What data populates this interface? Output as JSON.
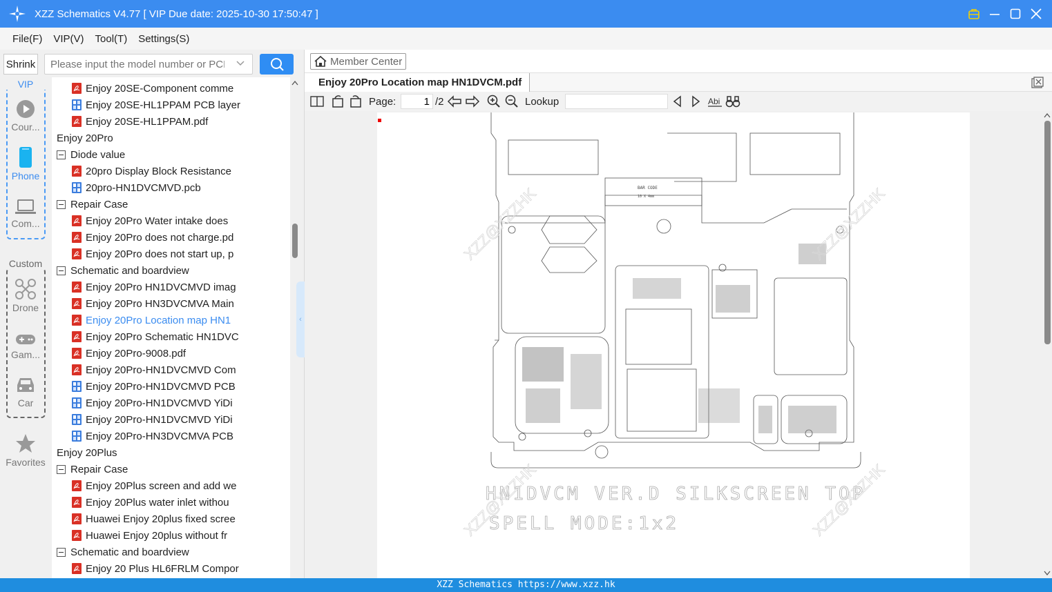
{
  "window": {
    "title": "XZZ Schematics V4.77 [ VIP Due date: 2025-10-30 17:50:47 ]"
  },
  "menu": [
    "File(F)",
    "VIP(V)",
    "Tool(T)",
    "Settings(S)"
  ],
  "sidebar": {
    "shrink_label": "Shrink",
    "search_placeholder": "Please input the model number or PCB",
    "vip_label": "VIP",
    "custom_label": "Custom",
    "categories": {
      "course": "Cour...",
      "phone": "Phone",
      "computer": "Com...",
      "drone": "Drone",
      "game": "Gam...",
      "car": "Car",
      "favorites": "Favorites"
    }
  },
  "tree": [
    {
      "level": 2,
      "kind": "pdf",
      "label": "Enjoy 20SE-Component comme"
    },
    {
      "level": 2,
      "kind": "pcb",
      "label": "Enjoy 20SE-HL1PPAM PCB layer"
    },
    {
      "level": 2,
      "kind": "pdf",
      "label": "Enjoy 20SE-HL1PPAM.pdf"
    },
    {
      "level": 0,
      "kind": "folder",
      "label": "Enjoy 20Pro"
    },
    {
      "level": 1,
      "kind": "folder",
      "label": "Diode value"
    },
    {
      "level": 2,
      "kind": "pdf",
      "label": "20pro Display Block Resistance"
    },
    {
      "level": 2,
      "kind": "pcb",
      "label": "20pro-HN1DVCMVD.pcb"
    },
    {
      "level": 1,
      "kind": "folder",
      "label": "Repair Case"
    },
    {
      "level": 2,
      "kind": "pdf",
      "label": "Enjoy 20Pro Water intake does"
    },
    {
      "level": 2,
      "kind": "pdf",
      "label": "Enjoy 20Pro does not charge.pd"
    },
    {
      "level": 2,
      "kind": "pdf",
      "label": "Enjoy 20Pro does not start up, p"
    },
    {
      "level": 1,
      "kind": "folder",
      "label": "Schematic and boardview"
    },
    {
      "level": 2,
      "kind": "pdf",
      "label": "Enjoy 20Pro HN1DVCMVD imag"
    },
    {
      "level": 2,
      "kind": "pdf",
      "label": "Enjoy 20Pro HN3DVCMVA Main"
    },
    {
      "level": 2,
      "kind": "pdf",
      "label": "Enjoy 20Pro Location map HN1",
      "active": true
    },
    {
      "level": 2,
      "kind": "pdf",
      "label": "Enjoy 20Pro Schematic HN1DVC"
    },
    {
      "level": 2,
      "kind": "pdf",
      "label": "Enjoy 20Pro-9008.pdf"
    },
    {
      "level": 2,
      "kind": "pdf",
      "label": "Enjoy 20Pro-HN1DVCMVD Com"
    },
    {
      "level": 2,
      "kind": "pcb",
      "label": "Enjoy 20Pro-HN1DVCMVD PCB"
    },
    {
      "level": 2,
      "kind": "pcb",
      "label": "Enjoy 20Pro-HN1DVCMVD YiDi"
    },
    {
      "level": 2,
      "kind": "pcb",
      "label": "Enjoy 20Pro-HN1DVCMVD YiDi"
    },
    {
      "level": 2,
      "kind": "pcb",
      "label": "Enjoy 20Pro-HN3DVCMVA PCB"
    },
    {
      "level": 0,
      "kind": "folder",
      "label": "Enjoy 20Plus"
    },
    {
      "level": 1,
      "kind": "folder",
      "label": "Repair Case"
    },
    {
      "level": 2,
      "kind": "pdf",
      "label": "Enjoy 20Plus screen and add we"
    },
    {
      "level": 2,
      "kind": "pdf",
      "label": "Enjoy 20Plus water inlet withou"
    },
    {
      "level": 2,
      "kind": "pdf",
      "label": "Huawei Enjoy 20plus fixed scree"
    },
    {
      "level": 2,
      "kind": "pdf",
      "label": "Huawei Enjoy 20plus without fr"
    },
    {
      "level": 1,
      "kind": "folder",
      "label": "Schematic and boardview"
    },
    {
      "level": 2,
      "kind": "pdf",
      "label": "Enjoy 20 Plus HL6FRLM Compor"
    }
  ],
  "viewer": {
    "member_center": "Member Center",
    "tab_title": "Enjoy 20Pro Location map HN1DVCM.pdf",
    "page_label": "Page:",
    "page_current": "1",
    "page_total": "/2",
    "lookup_label": "Lookup",
    "doc_line1": "HN1DVCM VER.D SILKSCREEN TOP",
    "doc_line2": "SPELL MODE:1x2",
    "barcode_label": "BAR CODE",
    "barcode_size": "10 X 4mm",
    "watermark": "XZZ@XZZHK"
  },
  "status": "XZZ Schematics https://www.xzz.hk",
  "colors": {
    "accent": "#3b8cf0",
    "status_bar": "#1f8ddf",
    "pdf_icon": "#d93025",
    "pcb_icon": "#3b7ddd"
  }
}
